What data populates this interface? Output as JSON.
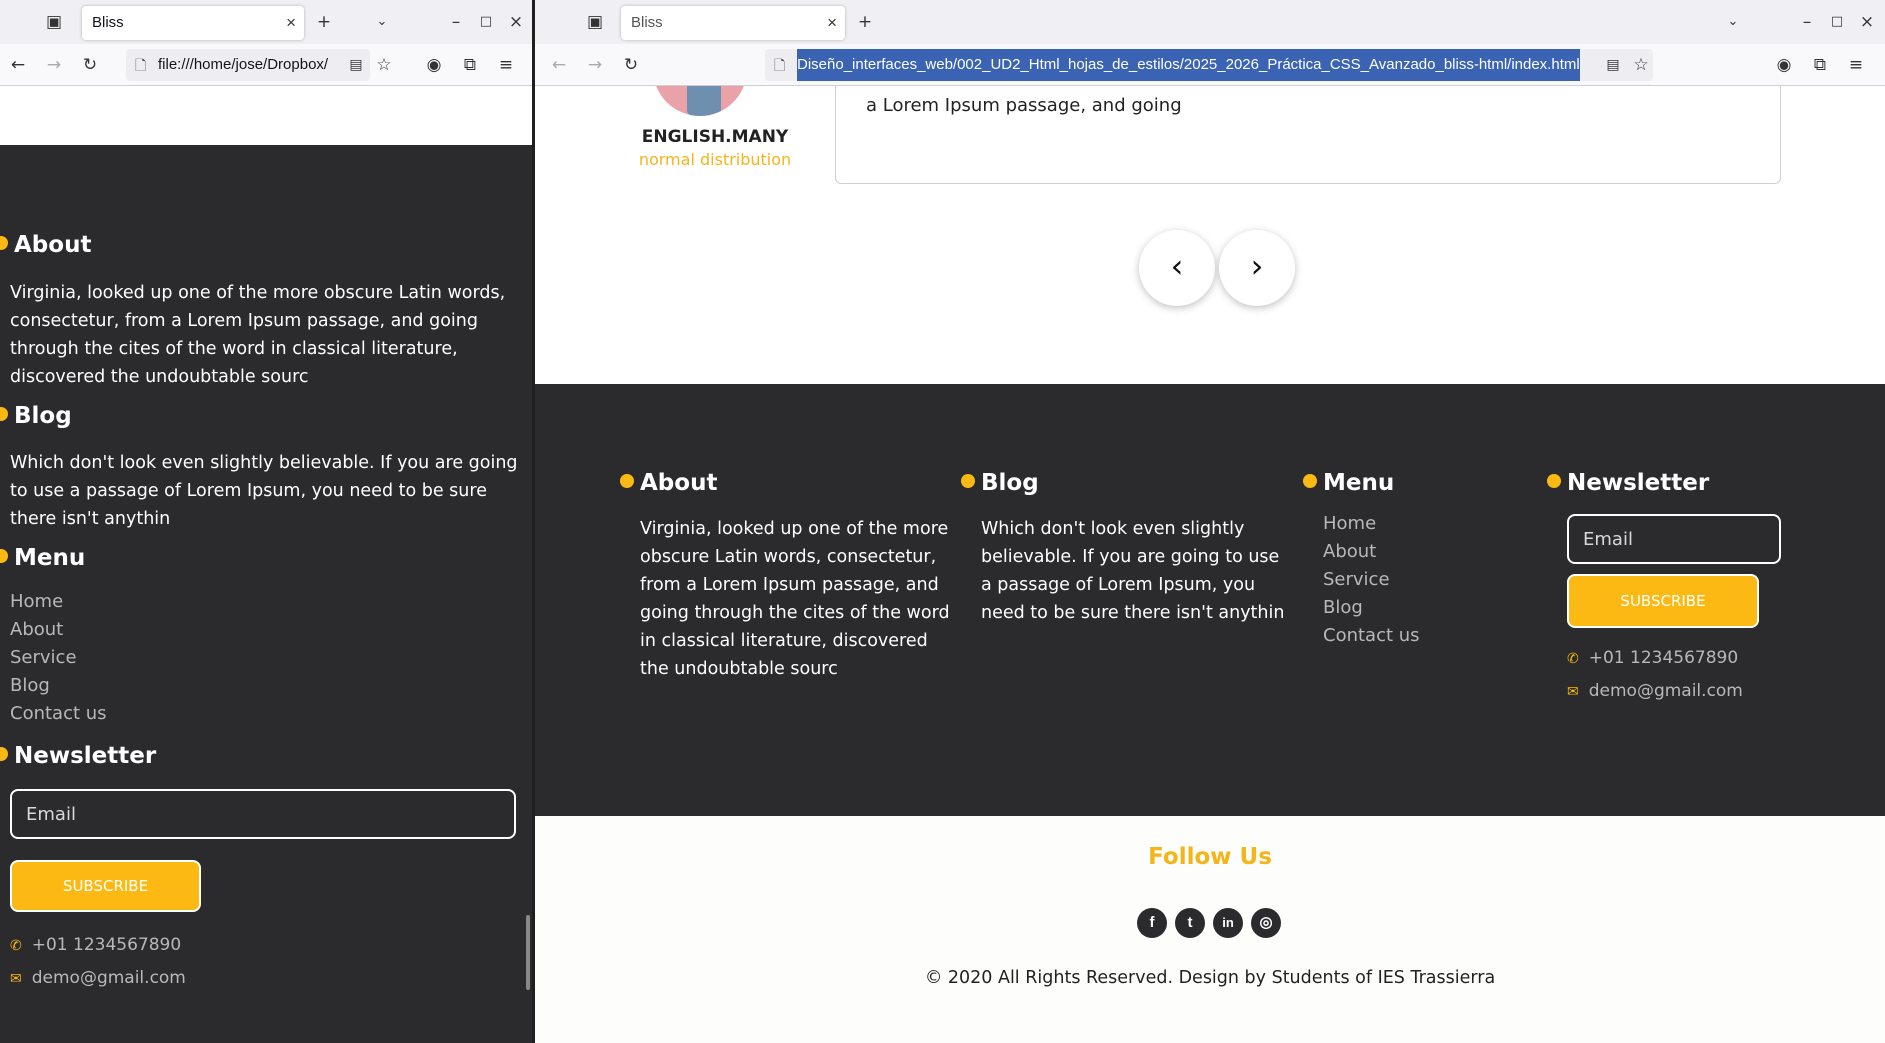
{
  "browser_left": {
    "tab_title": "Bliss",
    "tab_close": "×",
    "new_tab": "+",
    "url": "file:///home/jose/Dropbox/",
    "window_controls": {
      "minimize": "–",
      "maximize": "□",
      "close": "×"
    }
  },
  "browser_right": {
    "tab_title": "Bliss",
    "tab_close": "×",
    "new_tab": "+",
    "url": "Diseño_interfaces_web/002_UD2_Html_hojas_de_estilos/2025_2026_Práctica_CSS_Avanzado_bliss-html/index.html",
    "window_controls": {
      "minimize": "–",
      "maximize": "□",
      "close": "×"
    }
  },
  "testimonial": {
    "name": "ENGLISH.MANY",
    "role": "normal distribution",
    "text_line": "a Lorem Ipsum passage, and going",
    "prev": "‹",
    "next": "›"
  },
  "footer": {
    "about": {
      "title": "About",
      "text": "Virginia, looked up one of the more obscure Latin words, consectetur, from a Lorem Ipsum passage, and going through the cites of the word in classical literature, discovered the undoubtable sourc"
    },
    "blog": {
      "title": "Blog",
      "text": "Which don't look even slightly believable. If you are going to use a passage of Lorem Ipsum, you need to be sure there isn't anythin"
    },
    "menu": {
      "title": "Menu",
      "items": [
        "Home",
        "About",
        "Service",
        "Blog",
        "Contact us"
      ]
    },
    "newsletter": {
      "title": "Newsletter",
      "email_placeholder": "Email",
      "subscribe": "SUBSCRIBE",
      "phone": "+01 1234567890",
      "email": "demo@gmail.com"
    }
  },
  "follow": {
    "title": "Follow Us",
    "icons": [
      "facebook-icon",
      "twitter-icon",
      "linkedin-icon",
      "instagram-icon"
    ],
    "glyphs": {
      "facebook": "f",
      "twitter": "t",
      "linkedin": "in",
      "instagram": "◎"
    },
    "copyright": "© 2020 All Rights Reserved. Design by Students of IES Trassierra"
  },
  "colors": {
    "accent": "#fdb913",
    "footer_bg": "#2b2b2d",
    "menu_text": "#b8b8b8",
    "follow_title": "#f4b41a"
  }
}
